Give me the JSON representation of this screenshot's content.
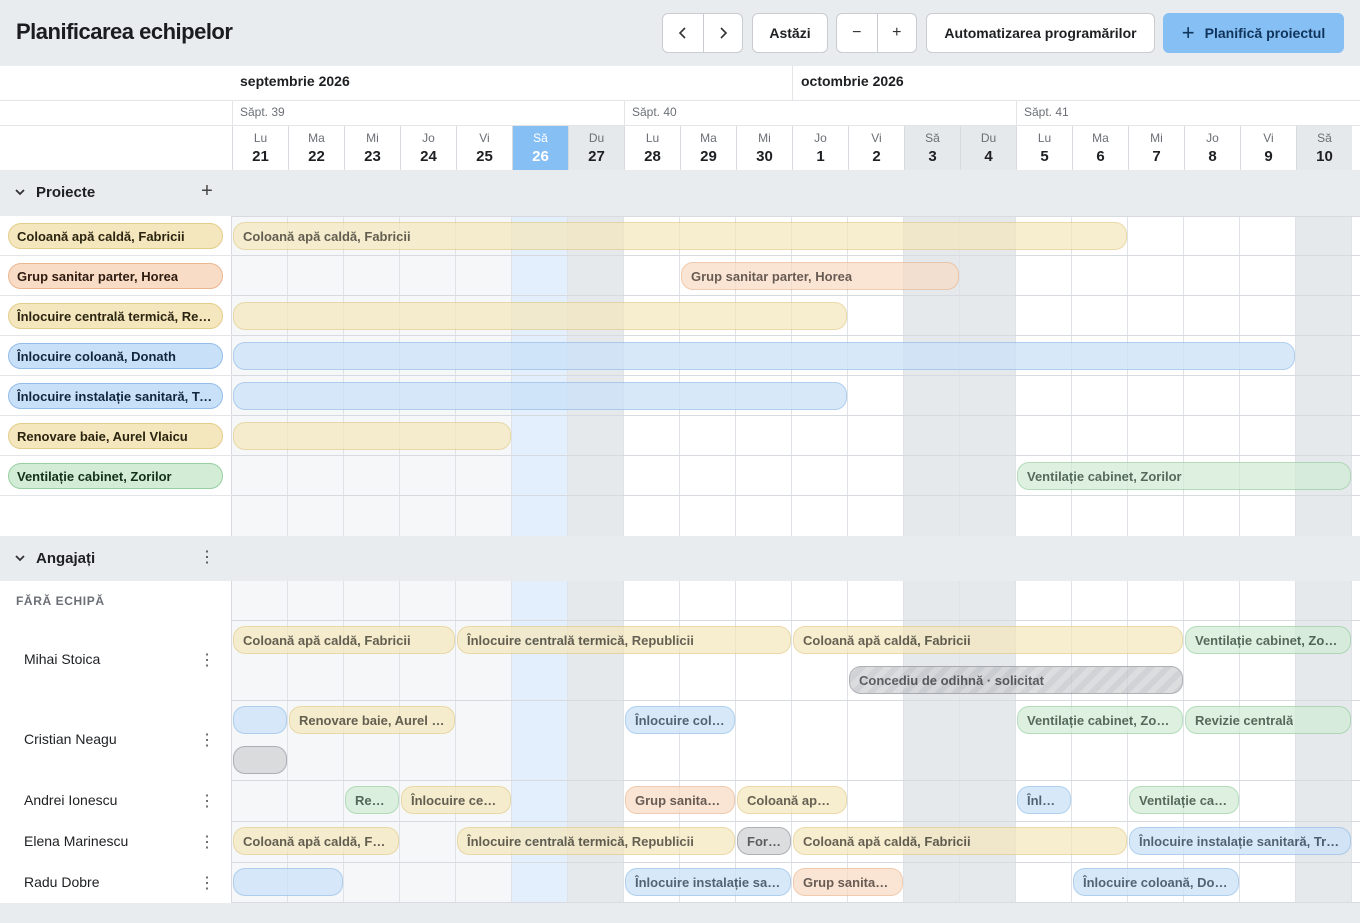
{
  "header": {
    "title": "Planificarea echipelor",
    "prev_icon": "chevron-left-icon",
    "next_icon": "chevron-right-icon",
    "today_label": "Astăzi",
    "zoom_out_label": "−",
    "zoom_in_label": "+",
    "automation_label": "Automatizarea programărilor",
    "plan_label": "Planifică proiectul",
    "plan_icon": "plus-icon",
    "accent": "#86bff3"
  },
  "calendar": {
    "months": [
      "septembrie 2026",
      "octombrie 2026"
    ],
    "weeks": [
      "Săpt. 39",
      "Săpt. 40",
      "Săpt. 41"
    ],
    "days": [
      {
        "n": "Lu",
        "d": "21"
      },
      {
        "n": "Ma",
        "d": "22"
      },
      {
        "n": "Mi",
        "d": "23"
      },
      {
        "n": "Jo",
        "d": "24"
      },
      {
        "n": "Vi",
        "d": "25"
      },
      {
        "n": "Să",
        "d": "26"
      },
      {
        "n": "Du",
        "d": "27"
      },
      {
        "n": "Lu",
        "d": "28"
      },
      {
        "n": "Ma",
        "d": "29"
      },
      {
        "n": "Mi",
        "d": "30"
      },
      {
        "n": "Jo",
        "d": "1"
      },
      {
        "n": "Vi",
        "d": "2"
      },
      {
        "n": "Să",
        "d": "3"
      },
      {
        "n": "Du",
        "d": "4"
      },
      {
        "n": "Lu",
        "d": "5"
      },
      {
        "n": "Ma",
        "d": "6"
      },
      {
        "n": "Mi",
        "d": "7"
      },
      {
        "n": "Jo",
        "d": "8"
      },
      {
        "n": "Vi",
        "d": "9"
      },
      {
        "n": "Să",
        "d": "10"
      }
    ],
    "today_day": "26"
  },
  "projects": {
    "section_label": "Proiecte",
    "items": [
      {
        "name": "Coloană apă caldă, Fabricii",
        "color": "yellow"
      },
      {
        "name": "Grup sanitar parter, Horea",
        "color": "orange"
      },
      {
        "name": "Înlocuire centrală termică, Republicii",
        "color": "yellow"
      },
      {
        "name": "Înlocuire coloană, Donath",
        "color": "blue"
      },
      {
        "name": "Înlocuire instalație sanitară, Traian",
        "color": "blue"
      },
      {
        "name": "Renovare baie, Aurel Vlaicu",
        "color": "yellow"
      },
      {
        "name": "Ventilație cabinet, Zorilor",
        "color": "green"
      }
    ],
    "bars": [
      {
        "row": 0,
        "start": 0,
        "end": 15,
        "color": "yellow",
        "label": "Coloană apă caldă, Fabricii"
      },
      {
        "row": 1,
        "start": 8,
        "end": 12,
        "color": "orange",
        "label": "Grup sanitar parter, Horea"
      },
      {
        "row": 2,
        "start": 0,
        "end": 10,
        "color": "yellow",
        "label": ""
      },
      {
        "row": 3,
        "start": 0,
        "end": 18,
        "color": "blue",
        "label": ""
      },
      {
        "row": 4,
        "start": 0,
        "end": 10,
        "color": "blue",
        "label": ""
      },
      {
        "row": 5,
        "start": 0,
        "end": 4,
        "color": "yellow",
        "label": ""
      },
      {
        "row": 6,
        "start": 14,
        "end": 19,
        "color": "green",
        "label": "Ventilație cabinet, Zorilor"
      }
    ]
  },
  "employees": {
    "section_label": "Angajați",
    "group_label": "FĂRĂ ECHIPĂ",
    "people": [
      {
        "name": "Mihai Stoica"
      },
      {
        "name": "Cristian Neagu"
      },
      {
        "name": "Andrei Ionescu"
      },
      {
        "name": "Elena Marinescu"
      },
      {
        "name": "Radu Dobre"
      }
    ],
    "bars": [
      {
        "person": 0,
        "lane": 0,
        "start": 0,
        "end": 3,
        "color": "yellow",
        "label": "Coloană apă caldă, Fabricii"
      },
      {
        "person": 0,
        "lane": 0,
        "start": 4,
        "end": 9,
        "color": "yellow",
        "label": "Înlocuire centrală termică, Republicii"
      },
      {
        "person": 0,
        "lane": 0,
        "start": 10,
        "end": 16,
        "color": "yellow",
        "label": "Coloană apă caldă, Fabricii"
      },
      {
        "person": 0,
        "lane": 0,
        "start": 17,
        "end": 19,
        "color": "green",
        "label": "Ventilație cabinet, Zorilor"
      },
      {
        "person": 0,
        "lane": 1,
        "start": 11,
        "end": 16,
        "color": "hatch",
        "label": "Concediu de odihnă · solicitat"
      },
      {
        "person": 1,
        "lane": 0,
        "start": 0,
        "end": 0,
        "color": "blue",
        "label": ""
      },
      {
        "person": 1,
        "lane": 0,
        "start": 1,
        "end": 3,
        "color": "yellow",
        "label": "Renovare baie, Aurel Vlaicu"
      },
      {
        "person": 1,
        "lane": 0,
        "start": 7,
        "end": 8,
        "color": "blue",
        "label": "Înlocuire coloană, Donath"
      },
      {
        "person": 1,
        "lane": 0,
        "start": 14,
        "end": 16,
        "color": "green",
        "label": "Ventilație cabinet, Zorilor"
      },
      {
        "person": 1,
        "lane": 0,
        "start": 17,
        "end": 19,
        "color": "green",
        "label": "Revizie centrală"
      },
      {
        "person": 1,
        "lane": 1,
        "start": 0,
        "end": 0,
        "color": "gray",
        "label": ""
      },
      {
        "person": 2,
        "lane": 0,
        "start": 2,
        "end": 2,
        "color": "green",
        "label": "Revizie centrală"
      },
      {
        "person": 2,
        "lane": 0,
        "start": 3,
        "end": 4,
        "color": "yellow",
        "label": "Înlocuire centrală termică, Republicii"
      },
      {
        "person": 2,
        "lane": 0,
        "start": 7,
        "end": 8,
        "color": "orange",
        "label": "Grup sanitar parter, Horea"
      },
      {
        "person": 2,
        "lane": 0,
        "start": 9,
        "end": 10,
        "color": "yellow",
        "label": "Coloană apă caldă, Fabricii"
      },
      {
        "person": 2,
        "lane": 0,
        "start": 14,
        "end": 14,
        "color": "blue",
        "label": "Înlocuire coloană, Donath"
      },
      {
        "person": 2,
        "lane": 0,
        "start": 16,
        "end": 17,
        "color": "green",
        "label": "Ventilație cabinet, Zorilor"
      },
      {
        "person": 3,
        "lane": 0,
        "start": 0,
        "end": 2,
        "color": "yellow",
        "label": "Coloană apă caldă, Fabricii"
      },
      {
        "person": 3,
        "lane": 0,
        "start": 4,
        "end": 8,
        "color": "yellow",
        "label": "Înlocuire centrală termică, Republicii"
      },
      {
        "person": 3,
        "lane": 0,
        "start": 9,
        "end": 9,
        "color": "gray",
        "label": "Formare"
      },
      {
        "person": 3,
        "lane": 0,
        "start": 10,
        "end": 15,
        "color": "yellow",
        "label": "Coloană apă caldă, Fabricii"
      },
      {
        "person": 3,
        "lane": 0,
        "start": 16,
        "end": 19,
        "color": "blue",
        "label": "Înlocuire instalație sanitară, Traian"
      },
      {
        "person": 4,
        "lane": 0,
        "start": 0,
        "end": 1,
        "color": "blue",
        "label": ""
      },
      {
        "person": 4,
        "lane": 0,
        "start": 7,
        "end": 9,
        "color": "blue",
        "label": "Înlocuire instalație sanitară, Traian"
      },
      {
        "person": 4,
        "lane": 0,
        "start": 10,
        "end": 11,
        "color": "orange",
        "label": "Grup sanitar parter, Horea"
      },
      {
        "person": 4,
        "lane": 0,
        "start": 15,
        "end": 17,
        "color": "blue",
        "label": "Înlocuire coloană, Donath"
      }
    ]
  }
}
